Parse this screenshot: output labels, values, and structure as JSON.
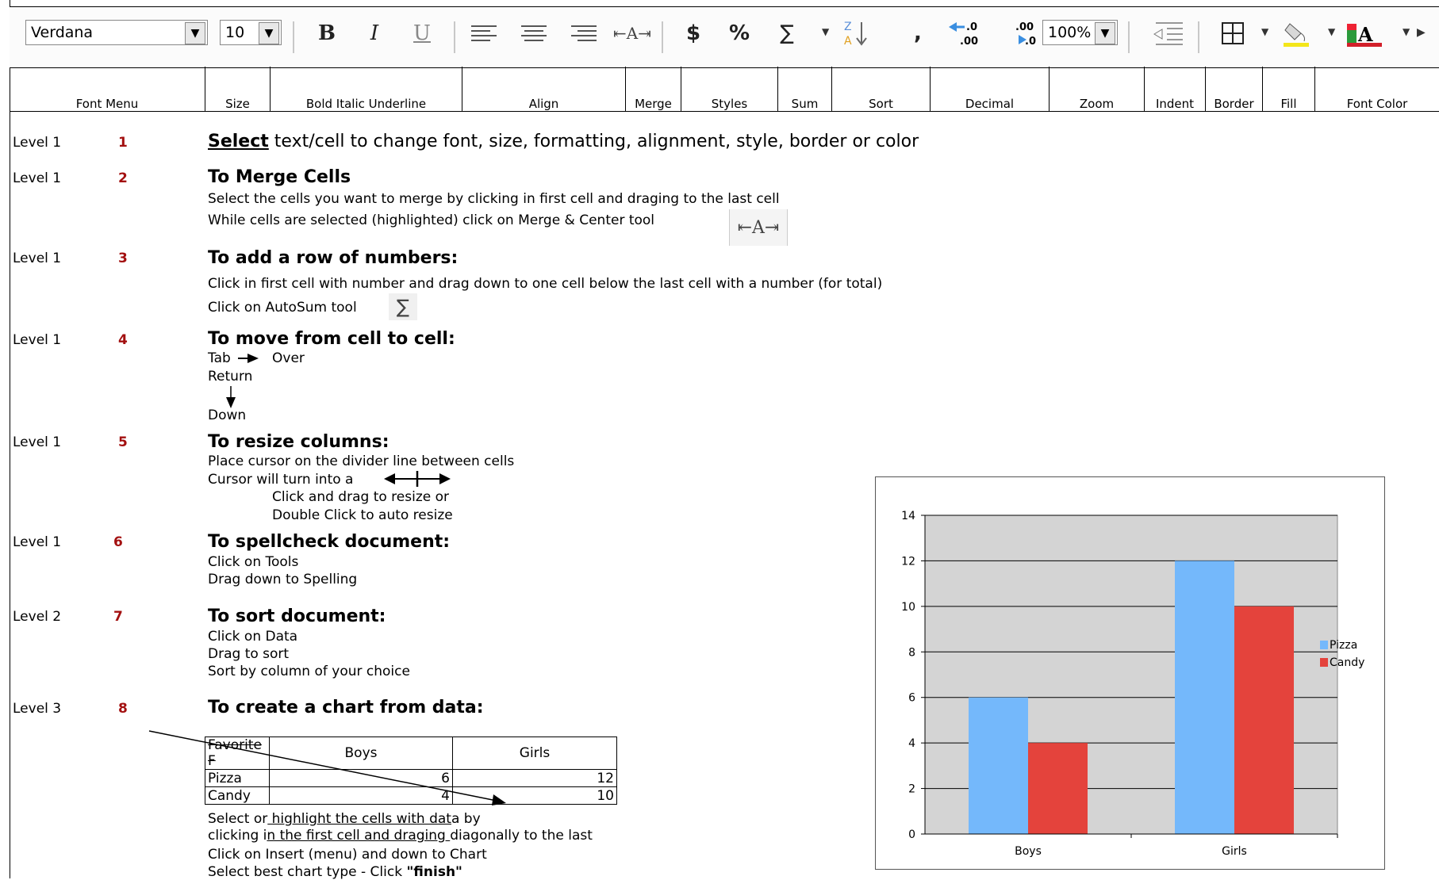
{
  "toolbar": {
    "font_name": "Verdana",
    "font_size": "10",
    "bold_label": "B",
    "italic_label": "I",
    "underline_label": "U",
    "merge_glyph": "⇤A⇥",
    "currency_label": "$",
    "percent_label": "%",
    "sum_label": "∑",
    "comma_label": ",",
    "zoom_value": "100%"
  },
  "labels": [
    "Font Menu",
    "Size",
    "Bold Italic Underline",
    "Align",
    "Merge",
    "Styles",
    "Sum",
    "Sort",
    "Decimal",
    "Zoom",
    "Indent",
    "Border",
    "Fill",
    "Font Color"
  ],
  "steps": [
    {
      "level": "Level 1",
      "num": "1"
    },
    {
      "level": "Level 1",
      "num": "2"
    },
    {
      "level": "Level 1",
      "num": "3"
    },
    {
      "level": "Level 1",
      "num": "4"
    },
    {
      "level": "Level 1",
      "num": "5"
    },
    {
      "level": "Level 1",
      "num": "6"
    },
    {
      "level": "Level 2",
      "num": "7"
    },
    {
      "level": "Level 3",
      "num": "8"
    }
  ],
  "s1": {
    "select": "Select",
    "rest": " text/cell to change font, size, formatting, alignment, style, border or color"
  },
  "s2": {
    "title": "To Merge Cells",
    "l1": "Select the cells  you want to merge by clicking in first cell and draging to the last cell",
    "l2": "While cells are selected (highlighted) click on Merge & Center tool"
  },
  "s3": {
    "title": "To add a row of numbers:",
    "l1": "Click in first cell with number and drag down to one cell below the last cell with a number (for total)",
    "l2": "Click on AutoSum tool"
  },
  "s4": {
    "title": "To move from cell to cell:",
    "tab": "Tab",
    "over": "Over",
    "return": "Return",
    "down": "Down"
  },
  "s5": {
    "title": "To resize columns:",
    "l1": "Place cursor on the divider line between cells",
    "l2": "Cursor will turn into a",
    "l3": "Click and drag to resize or",
    "l4": "Double Click to auto resize"
  },
  "s6": {
    "title": "To spellcheck document:",
    "l1": "Click on Tools",
    "l2": "Drag down to Spelling"
  },
  "s7": {
    "title": "To sort document:",
    "l1": "Click on Data",
    "l2": "Drag to sort",
    "l3": "Sort by column of your choice"
  },
  "s8": {
    "title": "To create a chart from data:",
    "l1a": "Select or",
    "l1b": " highlight the cells with dat",
    "l1c": "a by",
    "l2a": "clicking i",
    "l2b": "n the first cell and draging ",
    "l2c": "diagonally to the last",
    "l3": "Click on Insert (menu) and down to Chart",
    "l4a": "Select best chart type - Click ",
    "l4b": "\"finish\""
  },
  "table": {
    "header": [
      "Favorite F",
      "Boys",
      "Girls"
    ],
    "rows": [
      [
        "Pizza",
        "6",
        "12"
      ],
      [
        "Candy",
        "4",
        "10"
      ]
    ]
  },
  "chart_data": {
    "type": "bar",
    "categories": [
      "Boys",
      "Girls"
    ],
    "series": [
      {
        "name": "Pizza",
        "values": [
          6,
          12
        ]
      },
      {
        "name": "Candy",
        "values": [
          4,
          10
        ]
      }
    ],
    "ylim": [
      0,
      14
    ],
    "yticks": [
      "0",
      "2",
      "4",
      "6",
      "8",
      "10",
      "12",
      "14"
    ],
    "colors": {
      "Pizza": "#74b8fb",
      "Candy": "#e4433c",
      "plot_bg": "#d4d4d4"
    },
    "legend": "right",
    "grid": true
  }
}
